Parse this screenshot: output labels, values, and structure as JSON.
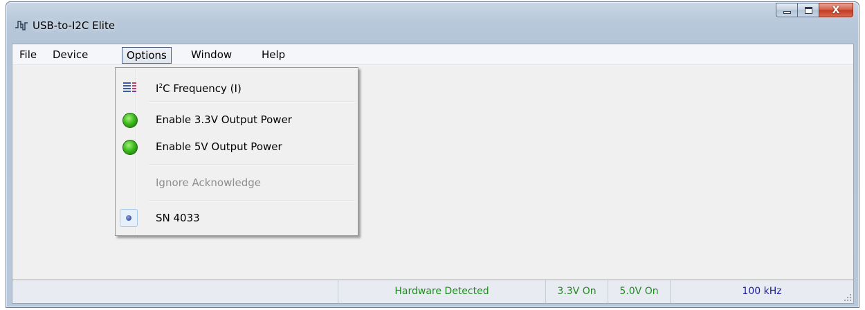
{
  "window": {
    "title": "USB-to-I2C Elite",
    "caption_buttons": {
      "minimize_icon": "minimize-icon",
      "maximize_icon": "maximize-icon",
      "close_label": "X"
    }
  },
  "menubar": {
    "items": [
      "File",
      "Device",
      "Options",
      "Window",
      "Help"
    ],
    "active": "Options"
  },
  "options_menu": {
    "i2c_frequency": {
      "prefix": "I",
      "sup": "2",
      "rest": "C Frequency (I)",
      "icon": "frequency-list-icon"
    },
    "enable_33v": {
      "label": "Enable 3.3V Output Power",
      "icon": "green-status-icon"
    },
    "enable_5v": {
      "label": "Enable 5V Output Power",
      "icon": "green-status-icon"
    },
    "ignore_ack": {
      "label": "Ignore Acknowledge",
      "enabled": false
    },
    "serial": {
      "label": "SN 4033",
      "icon": "radio-selected-icon",
      "selected": true
    }
  },
  "statusbar": {
    "hardware": "Hardware Detected",
    "v33": "3.3V On",
    "v50": "5.0V On",
    "freq": "100 kHz"
  },
  "colors": {
    "status_green": "#1f8a1f",
    "status_blue": "#1a1aa6",
    "menu_disabled": "#8d8d8d"
  }
}
